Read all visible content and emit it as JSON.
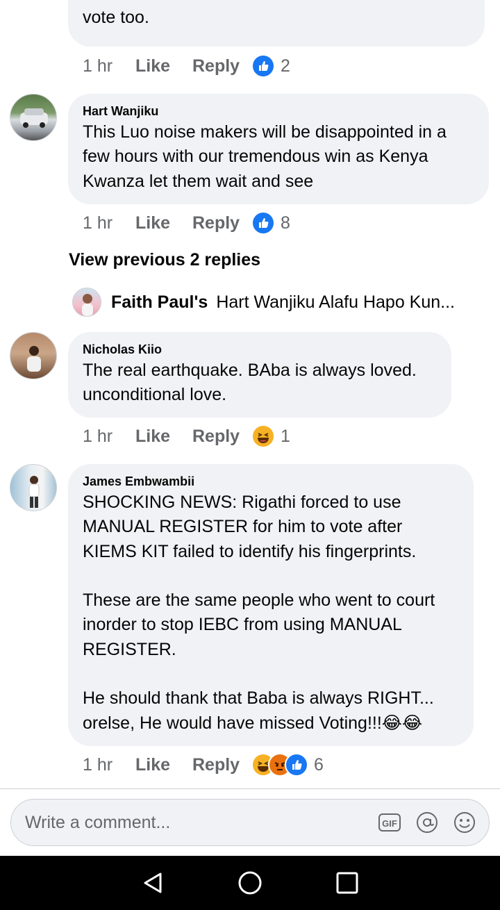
{
  "comments": [
    {
      "author": "",
      "text": "vote too.",
      "time": "1 hr",
      "like_label": "Like",
      "reply_label": "Reply",
      "reactions": [
        "like-icon"
      ],
      "reaction_count": "2"
    },
    {
      "author": "Hart Wanjiku",
      "text": "This Luo noise makers will be disappointed in a few hours with our tremendous win as Kenya Kwanza let them wait and see",
      "time": "1 hr",
      "like_label": "Like",
      "reply_label": "Reply",
      "reactions": [
        "like-icon"
      ],
      "reaction_count": "8"
    },
    {
      "author": "Nicholas Kiio",
      "text": "The real earthquake. BAba is always loved. unconditional love.",
      "time": "1 hr",
      "like_label": "Like",
      "reply_label": "Reply",
      "reactions": [
        "haha-icon"
      ],
      "reaction_count": "1"
    },
    {
      "author": "James Embwambii",
      "text": "SHOCKING NEWS: Rigathi forced to use MANUAL REGISTER for him to vote after KIEMS KIT failed to identify his fingerprints.\n\nThese are the same people who went to court inorder to stop IEBC from using MANUAL REGISTER.\n\nHe should thank that Baba is always RIGHT... orelse, He would have missed Voting!!!😂😂",
      "time": "1 hr",
      "like_label": "Like",
      "reply_label": "Reply",
      "reactions": [
        "haha-icon",
        "angry-icon",
        "like-icon"
      ],
      "reaction_count": "6"
    }
  ],
  "view_previous": "View previous 2 replies",
  "reply_preview": {
    "name": "Faith Paul's",
    "text": "Hart Wanjiku Alafu Hapo Kun..."
  },
  "composer": {
    "placeholder": "Write a comment..."
  },
  "colors": {
    "bubble": "#f0f2f5",
    "like_blue": "#1877f2",
    "meta_gray": "#65676b"
  }
}
